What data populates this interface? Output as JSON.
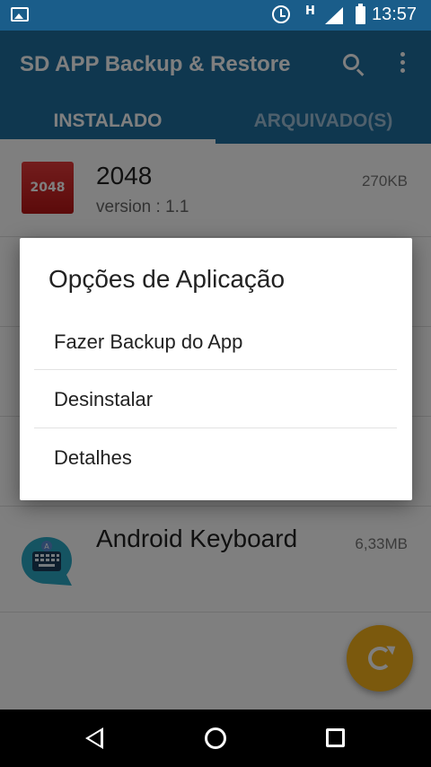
{
  "status_bar": {
    "network_type": "H",
    "time": "13:57",
    "icons": [
      "image-icon",
      "alarm-icon",
      "signal-icon",
      "battery-icon"
    ]
  },
  "app_bar": {
    "title": "SD APP Backup & Restore",
    "icons": [
      "search-icon",
      "more-vert-icon"
    ]
  },
  "tabs": [
    {
      "label": "INSTALADO",
      "active": true
    },
    {
      "label": "ARQUIVADO(S)",
      "active": false
    }
  ],
  "apps": [
    {
      "name": "2048",
      "version": "version : 1.1",
      "size": "270KB",
      "icon_text": "2048"
    },
    {
      "name": "Android Keyboard",
      "size": "6,33MB",
      "icon": "keyboard-icon"
    }
  ],
  "dialog": {
    "title": "Opções de Aplicação",
    "options": [
      {
        "label": "Fazer Backup do App"
      },
      {
        "label": "Desinstalar"
      },
      {
        "label": "Detalhes"
      }
    ]
  },
  "fab": {
    "icon": "refresh-icon"
  },
  "colors": {
    "app_bar": "#1f6e9f",
    "status_bar": "#1a5d8a",
    "fab": "#f6b21a",
    "scrim": "rgba(0,0,0,0.5)"
  },
  "nav_bar": {
    "icons": [
      "back-icon",
      "home-icon",
      "recents-icon"
    ]
  }
}
